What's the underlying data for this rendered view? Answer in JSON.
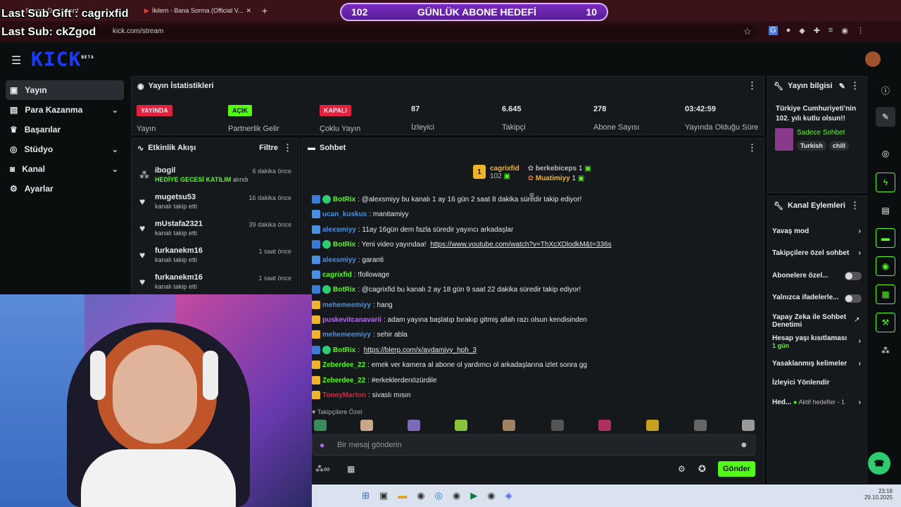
{
  "overlay": {
    "last_sub_gift": "Last Sub Gift : cagrixfid",
    "last_sub": "Last Sub: ckZgod"
  },
  "browser": {
    "tabs": [
      {
        "label": "Stream Dashboard"
      },
      {
        "label": "İkilem - Bana Sorma (Official V..."
      }
    ],
    "url": "kick.com/stream"
  },
  "goal": {
    "left": "102",
    "title": "GÜNLÜK ABONE HEDEFİ",
    "right": "10"
  },
  "logo": {
    "text": "KICK",
    "sub": "BETA"
  },
  "sidebar": {
    "items": [
      {
        "label": "Yayın"
      },
      {
        "label": "Para Kazanma"
      },
      {
        "label": "Başarılar"
      },
      {
        "label": "Stüdyo"
      },
      {
        "label": "Kanal"
      },
      {
        "label": "Ayarlar"
      }
    ]
  },
  "stats": {
    "title": "Yayın İstatistikleri",
    "items": [
      {
        "badge": "YAYINDA",
        "label": "Yayın",
        "color": "#e0223f"
      },
      {
        "badge": "AÇIK",
        "label": "Partnerlik Gelir",
        "color": "#53fc18"
      },
      {
        "badge": "KAPALI",
        "label": "Çoklu Yayın",
        "color": "#e0223f"
      },
      {
        "value": "87",
        "label": "İzleyici"
      },
      {
        "value": "6.645",
        "label": "Takipçi"
      },
      {
        "value": "278",
        "label": "Abone Sayısı"
      },
      {
        "value": "03:42:59",
        "label": "Yayında Olduğu Süre"
      }
    ]
  },
  "activity": {
    "title": "Etkinlik Akışı",
    "filter": "Filtre",
    "items": [
      {
        "name": "ibogil",
        "sub": "HEDİYE GECESİ KATILIM",
        "sub2": "alındı",
        "time": "6 dakika önce"
      },
      {
        "name": "mugetsu53",
        "sub": "kanalı takip etti",
        "time": "16 dakika önce"
      },
      {
        "name": "mUstafa2321",
        "sub": "kanalı takip etti",
        "time": "39 dakika önce"
      },
      {
        "name": "furkanekm16",
        "sub": "kanalı takip etti",
        "time": "1 saat önce"
      },
      {
        "name": "furkanekm16",
        "sub": "kanalı takip etti",
        "time": "1 saat önce"
      }
    ]
  },
  "chat": {
    "title": "Sohbet",
    "leader": {
      "rank": "1",
      "name": "cagrixfid",
      "count": "102",
      "second": "berkebiceps",
      "second_count": "1",
      "third": "Muatimiyy",
      "third_count": "1"
    },
    "messages": [
      {
        "user": "BotRix",
        "text": ": @alexsmiyy bu kanalı 1 ay 16 gün 2 saat 8 dakika süredir takip ediyor!",
        "color": "#53fc18"
      },
      {
        "user": "ucan_kuskus",
        "text": ": manitamiyy",
        "color": "#4a90e2"
      },
      {
        "user": "alexsmiyy",
        "text": ": 11ay 16gün dem fazla süredir yayıncı arkadaşlar",
        "color": "#4a90e2"
      },
      {
        "user": "BotRix",
        "text": ": Yeni video yayındaa! ",
        "link": "https://www.youtube.com/watch?v=ThXcXDlodkM&t=336s",
        "color": "#53fc18"
      },
      {
        "user": "alexsmiyy",
        "text": ": garanti",
        "color": "#4a90e2"
      },
      {
        "user": "cagrixfid",
        "text": ": !followage",
        "color": "#53fc18"
      },
      {
        "user": "BotRix",
        "text": ": @cagrixfid bu kanalı 2 ay 18 gün 9 saat 22 dakika süredir takip ediyor!",
        "color": "#53fc18"
      },
      {
        "user": "mehemeemiyy",
        "text": ": hang",
        "color": "#4a90e2"
      },
      {
        "user": "puskevitcanavarii",
        "text": ": adam yayına başlatıp bırakıp gitmiş allah razı olsun kendisinden",
        "color": "#b56cf0"
      },
      {
        "user": "mehemeemiyy",
        "text": ": sehir abla",
        "color": "#4a90e2"
      },
      {
        "user": "BotRix",
        "text": ": ",
        "link": "https://blerp.com/x/aydamiyy_hph_3",
        "color": "#53fc18"
      },
      {
        "user": "Zeberdee_22",
        "text": ": emek ver kamera al abone ol yardımcı ol arkadaşlarına izlet sonra gg",
        "color": "#53fc18"
      },
      {
        "user": "Zeberdee_22",
        "text": ": #erkeklerdenözürdile",
        "color": "#53fc18"
      },
      {
        "user": "ToneyMarton",
        "text": ": sivaslı mısın",
        "color": "#e0223f"
      }
    ],
    "followers_only": "Takipçilere Özel",
    "placeholder": "Bir mesaj gönderin",
    "send": "Gönder"
  },
  "stream_info": {
    "title": "Yayın bilgisi",
    "text": "Türkiye Cumhuriyeti'nin 102. yılı kutlu olsun!!",
    "category": "Sadece Sohbet",
    "tags": [
      "Turkish",
      "chill"
    ]
  },
  "channel_actions": {
    "title": "Kanal Eylemleri",
    "items": [
      {
        "label": "Yavaş mod"
      },
      {
        "label": "Takipçilere özel sohbet"
      },
      {
        "label": "Abonelere özel..."
      },
      {
        "label": "Yalnızca ifadelerle..."
      },
      {
        "label": "Yapay Zeka ile Sohbet Denetimi"
      },
      {
        "label": "Hesap yaşı kısıtlaması",
        "sub": "1 gün"
      },
      {
        "label": "Yasaklanmış kelimeler"
      },
      {
        "label": "İzleyici Yönlendir"
      },
      {
        "label": "Hed...",
        "sub": "Aktif hedefler - 1"
      }
    ]
  },
  "clock": {
    "time": "23:18",
    "date": "29.10.2025"
  }
}
